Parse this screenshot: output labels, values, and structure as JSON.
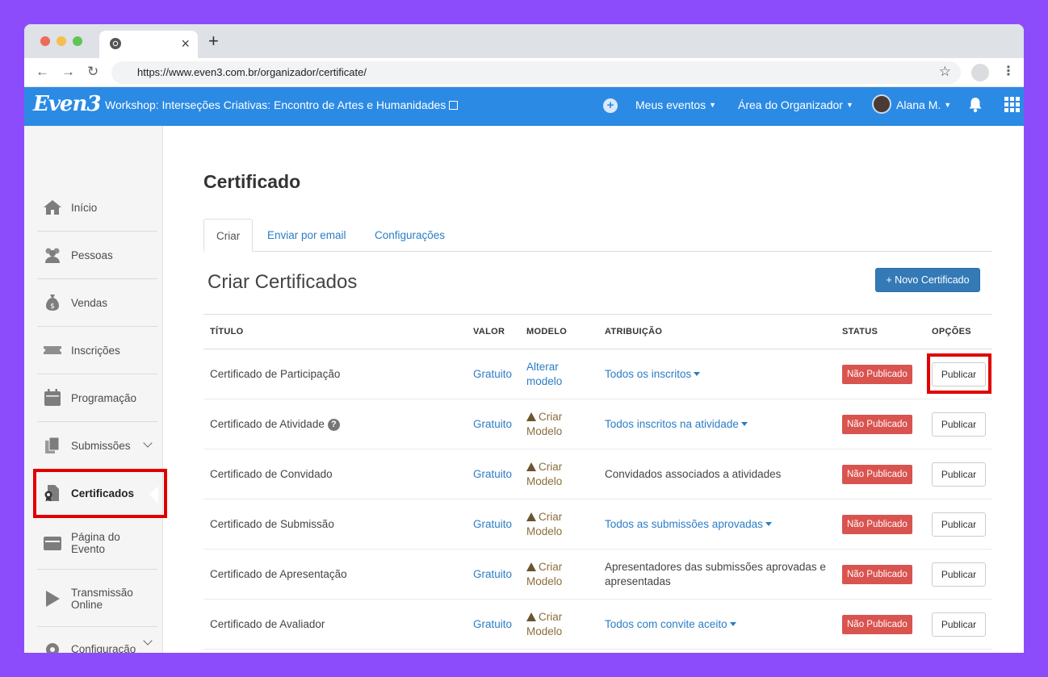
{
  "browser": {
    "url": "https://www.even3.com.br/organizador/certificate/"
  },
  "header": {
    "logo": "Even3",
    "event_title": "Workshop: Interseções Criativas: Encontro de Artes e Humanidades",
    "menu_events": "Meus eventos",
    "menu_organizer": "Área do Organizador",
    "user_name": "Alana M.",
    "brand_color": "#2b8ae4"
  },
  "sidebar": {
    "items": [
      {
        "label": "Início",
        "icon": "home-icon"
      },
      {
        "label": "Pessoas",
        "icon": "people-icon"
      },
      {
        "label": "Vendas",
        "icon": "money-bag-icon"
      },
      {
        "label": "Inscrições",
        "icon": "ticket-icon"
      },
      {
        "label": "Programação",
        "icon": "calendar-icon"
      },
      {
        "label": "Submissões",
        "icon": "files-icon"
      },
      {
        "label": "Certificados",
        "icon": "certificate-icon"
      },
      {
        "label": "Página do Evento",
        "icon": "browser-icon"
      },
      {
        "label": "Transmissão Online",
        "icon": "play-icon"
      },
      {
        "label": "Configuração",
        "icon": "gear-icon"
      }
    ],
    "active": "Certificados"
  },
  "main": {
    "page_title": "Certificado",
    "tabs": [
      "Criar",
      "Enviar por email",
      "Configurações"
    ],
    "section_title": "Criar Certificados",
    "new_button": "+ Novo Certificado",
    "columns": [
      "TÍTULO",
      "VALOR",
      "MODELO",
      "ATRIBUIÇÃO",
      "STATUS",
      "OPÇÕES"
    ],
    "rows": [
      {
        "title": "Certificado de Participação",
        "value": "Gratuito",
        "model": "Alterar modelo",
        "model_type": "link",
        "attribution": "Todos os inscritos",
        "attribution_dropdown": true,
        "status": "Não Publicado",
        "action": "Publicar"
      },
      {
        "title": "Certificado de Atividade",
        "has_help": true,
        "value": "Gratuito",
        "model": "Criar Modelo",
        "model_type": "warn",
        "attribution": "Todos inscritos na atividade",
        "attribution_dropdown": true,
        "status": "Não Publicado",
        "action": "Publicar"
      },
      {
        "title": "Certificado de Convidado",
        "value": "Gratuito",
        "model": "Criar Modelo",
        "model_type": "warn",
        "attribution": "Convidados associados a atividades",
        "attribution_dropdown": false,
        "status": "Não Publicado",
        "action": "Publicar"
      },
      {
        "title": "Certificado de Submissão",
        "value": "Gratuito",
        "model": "Criar Modelo",
        "model_type": "warn",
        "attribution": "Todos as submissões aprovadas",
        "attribution_dropdown": true,
        "status": "Não Publicado",
        "action": "Publicar"
      },
      {
        "title": "Certificado de Apresentação",
        "value": "Gratuito",
        "model": "Criar Modelo",
        "model_type": "warn",
        "attribution": "Apresentadores das submissões aprovadas e apresentadas",
        "attribution_dropdown": false,
        "status": "Não Publicado",
        "action": "Publicar"
      },
      {
        "title": "Certificado de Avaliador",
        "value": "Gratuito",
        "model": "Criar Modelo",
        "model_type": "warn",
        "attribution": "Todos com convite aceito",
        "attribution_dropdown": true,
        "status": "Não Publicado",
        "action": "Publicar"
      }
    ]
  }
}
